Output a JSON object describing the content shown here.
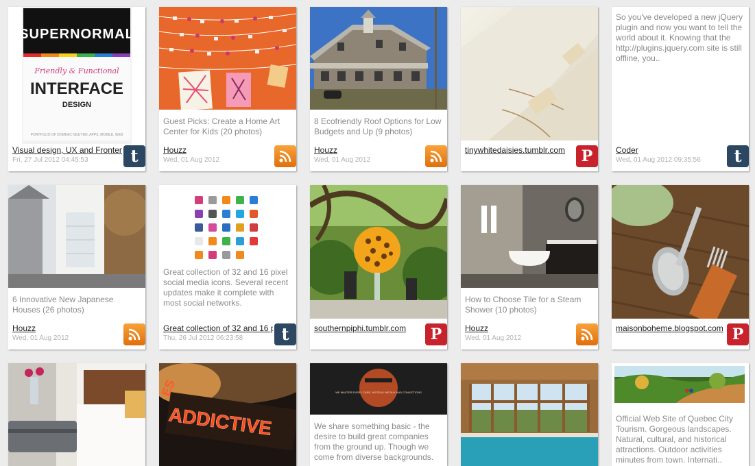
{
  "cards": [
    {
      "desc": "",
      "source": "Visual design, UX and Frontend",
      "date": "Fri, 27 Jul 2012 04:45:53",
      "badge": "t"
    },
    {
      "desc": "Guest Picks: Create a Home Art Center for Kids (20 photos)",
      "source": "Houzz",
      "date": "Wed, 01 Aug 2012",
      "badge": ""
    },
    {
      "desc": "8 Ecofriendly Roof Options for Low Budgets and Up (9 photos)",
      "source": "Houzz",
      "date": "Wed, 01 Aug 2012",
      "badge": ""
    },
    {
      "desc": "",
      "source": "tinywhitedaisies.tumblr.com",
      "date": "",
      "badge": "P"
    },
    {
      "desc": "So you've developed a new jQuery plugin and now you want to tell the world about it. Knowing that the http://plugins.jquery.com site is still offline, you..",
      "source": "Coder",
      "date": "Wed, 01 Aug 2012 09:35:56",
      "badge": "t"
    },
    {
      "desc": "6 Innovative New Japanese Houses (26 photos)",
      "source": "Houzz",
      "date": "Wed, 01 Aug 2012",
      "badge": ""
    },
    {
      "desc": "Great collection of 32 and 16 pixel social media icons. Several recent updates make it complete with most social networks.",
      "source": "Great collection of 32 and 16 pixel",
      "date": "Thu, 26 Jul 2012 06:23:58",
      "badge": "t"
    },
    {
      "desc": "",
      "source": "southernpiphi.tumblr.com",
      "date": "",
      "badge": "P"
    },
    {
      "desc": "How to Choose Tile for a Steam Shower (10 photos)",
      "source": "Houzz",
      "date": "Wed, 01 Aug 2012",
      "badge": ""
    },
    {
      "desc": "",
      "source": "maisonboheme.blogspot.com",
      "date": "",
      "badge": "P"
    },
    {
      "desc": "",
      "source": "",
      "date": "",
      "badge": ""
    },
    {
      "desc": "",
      "source": "",
      "date": "",
      "badge": ""
    },
    {
      "desc": "We share something basic - the desire to build great companies from the ground up. Though we come from diverse backgrounds.",
      "source": "",
      "date": "",
      "badge": ""
    },
    {
      "desc": "",
      "source": "",
      "date": "",
      "badge": ""
    },
    {
      "desc": "Official Web Site of Quebec City Tourism. Gorgeous landscapes. Natural, cultural, and historical attractions. Outdoor activities minutes from town. Internati..",
      "source": "",
      "date": "",
      "badge": ""
    }
  ],
  "images": {
    "can": {
      "brand": "SUPERNORMAL",
      "tagline": "Friendly & Functional",
      "title": "INTERFACE",
      "subtitle": "DESIGN",
      "footnote": "PORTFOLIO OF DOMINIC NGUYEN, APPS, MOBILE, WEB"
    },
    "neon": {
      "text": "ADDICTIVE",
      "side": "ES"
    },
    "logo_caption": "WE MASTER EVERY CARE, INSTEAD WE BUY AND CONVICTIONS"
  }
}
